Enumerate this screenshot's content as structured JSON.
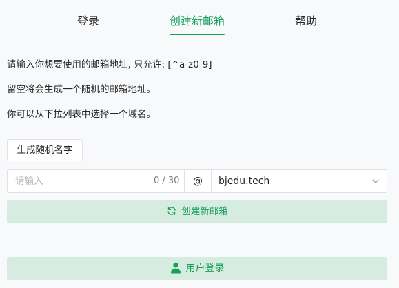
{
  "tabs": [
    {
      "label": "登录",
      "active": false
    },
    {
      "label": "创建新邮箱",
      "active": true
    },
    {
      "label": "帮助",
      "active": false
    }
  ],
  "instructions": {
    "line1": "请输入你想要使用的邮箱地址, 只允许: [^a-z0-9]",
    "line2": "留空将会生成一个随机的邮箱地址。",
    "line3": "你可以从下拉列表中选择一个域名。"
  },
  "random_button": {
    "label": "生成随机名字"
  },
  "name_input": {
    "placeholder": "请输入",
    "value": "",
    "counter": "0 / 30"
  },
  "at_symbol": "@",
  "domain_select": {
    "selected": "bjedu.tech",
    "icon": "chevron-down-icon"
  },
  "create_button": {
    "label": "创建新邮箱",
    "icon": "refresh-icon"
  },
  "login_button": {
    "label": "用户登录",
    "icon": "user-icon"
  },
  "colors": {
    "accent": "#18a058",
    "accent_bg": "#d6ece0",
    "border": "#e0e0e6",
    "background": "#f8f9fb"
  }
}
